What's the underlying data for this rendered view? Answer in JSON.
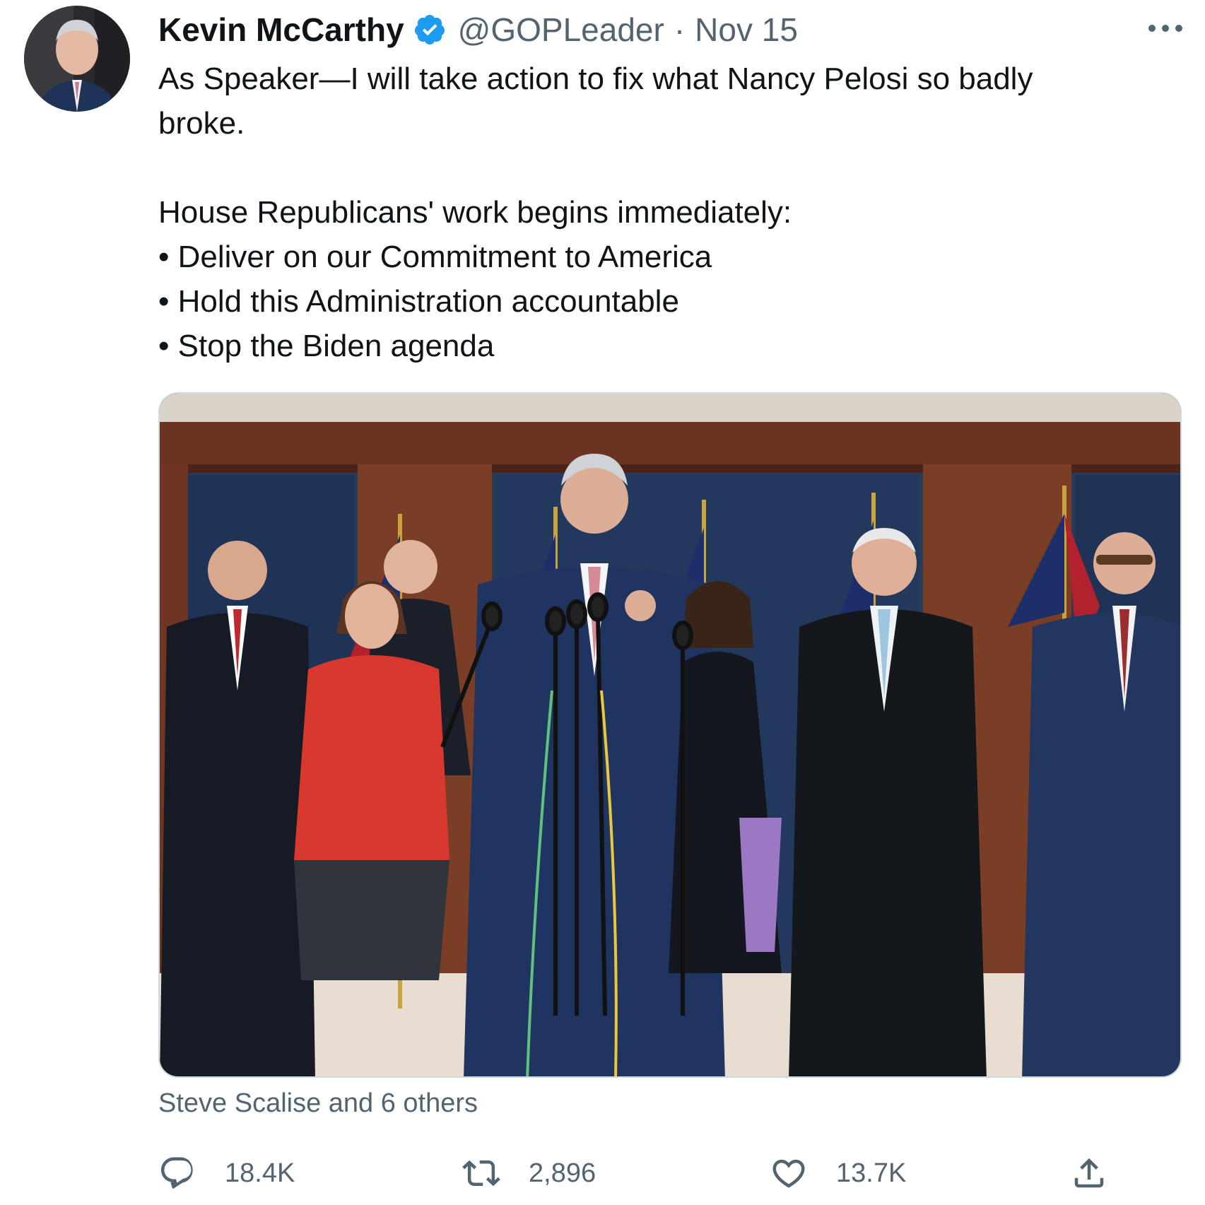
{
  "tweet": {
    "author_name": "Kevin McCarthy",
    "handle": "@GOPLeader",
    "separator": "·",
    "date": "Nov 15",
    "text_lines": [
      "As Speaker—I will take action to fix what Nancy Pelosi so badly",
      "broke.",
      "",
      "House Republicans' work begins immediately:",
      "• Deliver on our Commitment to America",
      "• Hold this Administration accountable",
      "• Stop the Biden agenda"
    ],
    "tagged": "Steve Scalise and 6 others",
    "stats": {
      "replies": "18.4K",
      "retweets": "2,896",
      "likes": "13.7K"
    }
  },
  "icons": {
    "verified": "verified-badge-icon",
    "more": "more-dots-icon",
    "reply": "reply-icon",
    "retweet": "retweet-icon",
    "like": "heart-icon",
    "share": "share-icon"
  },
  "colors": {
    "verified_blue": "#1d9bf0",
    "secondary_text": "#536471",
    "primary_text": "#0f1419"
  }
}
